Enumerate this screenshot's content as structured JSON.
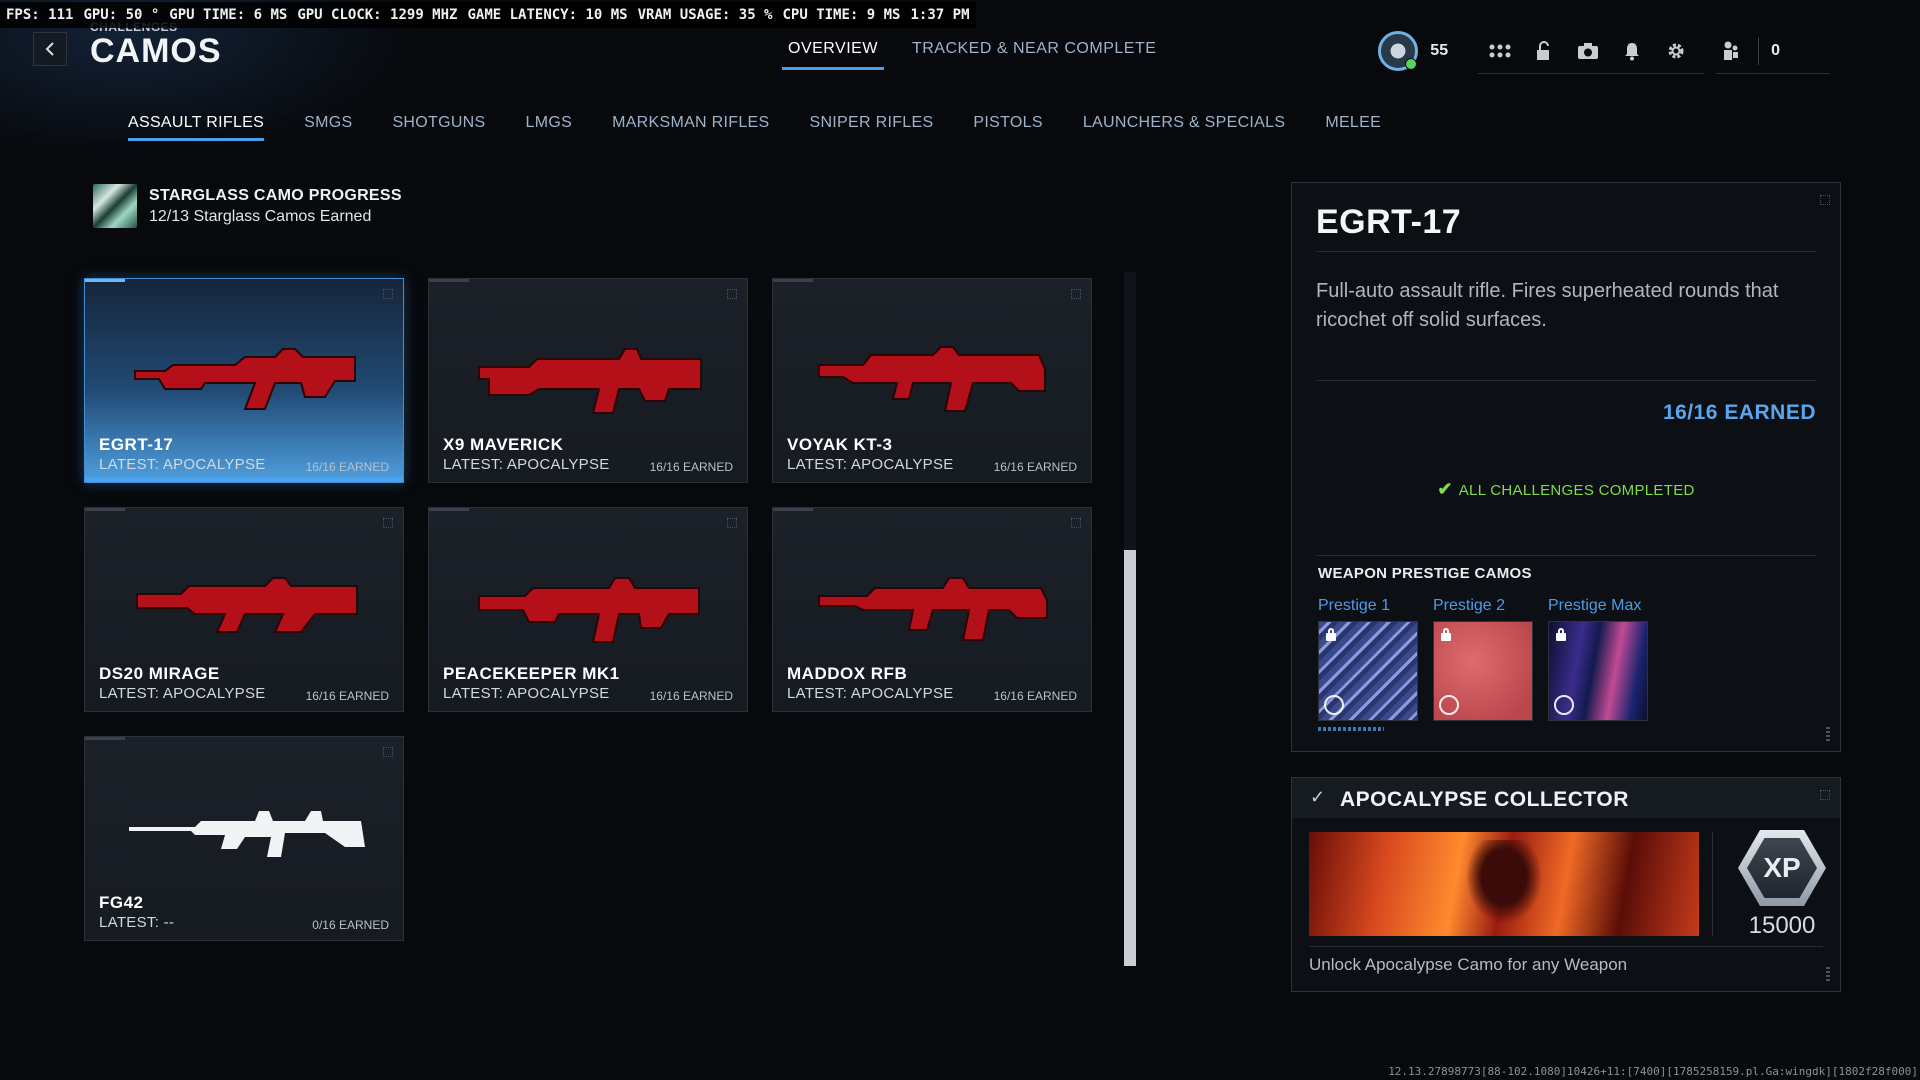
{
  "perf": {
    "fps": "FPS: 111",
    "gpu": "GPU: 50 °",
    "gpu_time": "GPU TIME:  6 MS",
    "gpu_clock": "GPU CLOCK: 1299 MHZ",
    "latency": "GAME LATENCY: 10 MS",
    "vram": "VRAM USAGE: 35 %",
    "cpu_time": "CPU TIME:  9 MS",
    "clock": "1:37 PM"
  },
  "header": {
    "breadcrumb": "CHALLENGES",
    "title": "CAMOS",
    "back_icon": "chevron-left-icon",
    "tabs": [
      "OVERVIEW",
      "TRACKED & NEAR COMPLETE"
    ],
    "active_tab": "OVERVIEW",
    "level": "55",
    "friends_count": "0",
    "icons": [
      "grid-menu-icon",
      "unlock-icon",
      "camera-icon",
      "bell-icon",
      "gear-icon",
      "friends-icon"
    ]
  },
  "categories": [
    "ASSAULT RIFLES",
    "SMGS",
    "SHOTGUNS",
    "LMGS",
    "MARKSMAN RIFLES",
    "SNIPER RIFLES",
    "PISTOLS",
    "LAUNCHERS & SPECIALS",
    "MELEE"
  ],
  "active_category": "ASSAULT RIFLES",
  "progress": {
    "title": "STARGLASS CAMO PROGRESS",
    "subtitle": "12/13 Starglass Camos Earned"
  },
  "weapons": [
    {
      "name": "EGRT-17",
      "latest": "LATEST: APOCALYPSE",
      "earned": "16/16 EARNED",
      "camo": "red"
    },
    {
      "name": "X9 MAVERICK",
      "latest": "LATEST: APOCALYPSE",
      "earned": "16/16 EARNED",
      "camo": "red"
    },
    {
      "name": "VOYAK KT-3",
      "latest": "LATEST: APOCALYPSE",
      "earned": "16/16 EARNED",
      "camo": "red"
    },
    {
      "name": "DS20 MIRAGE",
      "latest": "LATEST: APOCALYPSE",
      "earned": "16/16 EARNED",
      "camo": "red"
    },
    {
      "name": "PEACEKEEPER MK1",
      "latest": "LATEST: APOCALYPSE",
      "earned": "16/16 EARNED",
      "camo": "red"
    },
    {
      "name": "MADDOX RFB",
      "latest": "LATEST: APOCALYPSE",
      "earned": "16/16 EARNED",
      "camo": "red"
    },
    {
      "name": "FG42",
      "latest": "LATEST: --",
      "earned": "0/16 EARNED",
      "camo": "white"
    }
  ],
  "details": {
    "title": "EGRT-17",
    "description": "Full-auto assault rifle. Fires superheated rounds that ricochet off solid surfaces.",
    "earned": "16/16 EARNED",
    "completed": "ALL CHALLENGES COMPLETED",
    "prestige_title": "WEAPON PRESTIGE CAMOS",
    "prestige": [
      "Prestige 1",
      "Prestige 2",
      "Prestige Max"
    ]
  },
  "reward": {
    "title": "APOCALYPSE COLLECTOR",
    "xp_label": "XP",
    "xp_amount": "15000",
    "description": "Unlock Apocalypse Camo for any Weapon"
  },
  "colors": {
    "accent": "#4a9fe8",
    "earned_blue": "#5aa6ee",
    "complete_green": "#7fdc4b",
    "camo_red": "#b3101a"
  },
  "footer": "12.13.27898773[88-102.1080]10426+11:[7400][1785258159.pl.Ga:wingdk][1802f28f000]"
}
